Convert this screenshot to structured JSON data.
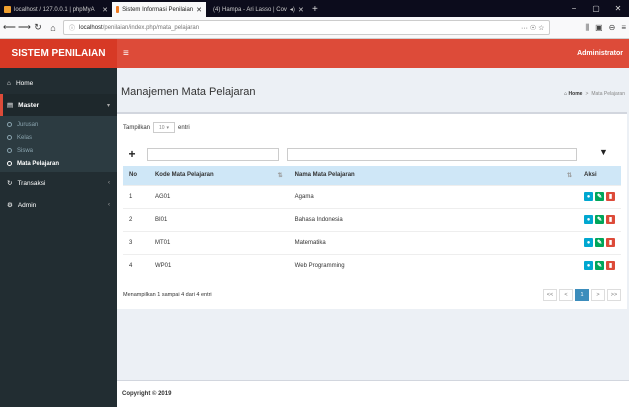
{
  "browser": {
    "tabs": [
      {
        "label": "localhost / 127.0.0.1 | phpMyA",
        "color": "#f0a030"
      },
      {
        "label": "Sistem Informasi Penilaian",
        "color": "#f07b20"
      },
      {
        "label": "(4) Hampa - Ari Lasso | Cov",
        "color": "#ff0000"
      }
    ],
    "new_tab": "+",
    "url_host": "localhost",
    "url_path": "/penilaian/index.php/mata_pelajaran",
    "url_icons": "··· ☉ ☆"
  },
  "app": {
    "logo": "SISTEM PENILAIAN",
    "user": "Administrator"
  },
  "sidebar": {
    "home": "Home",
    "master": "Master",
    "sub": [
      "Jurusan",
      "Kelas",
      "Siswa",
      "Mata Pelajaran"
    ],
    "transaksi": "Transaksi",
    "admin": "Admin"
  },
  "page": {
    "title": "Manajemen Mata Pelajaran",
    "crumb_home": "Home",
    "crumb_sep": ">",
    "crumb_current": "Mata Pelajaran"
  },
  "table": {
    "show_label": "Tampilkan",
    "show_value": "10",
    "entries_label": "entri",
    "headers": [
      "No",
      "Kode Mata Pelajaran",
      "Nama Mata Pelajaran",
      "Aksi"
    ],
    "rows": [
      {
        "no": "1",
        "kode": "AG01",
        "nama": "Agama"
      },
      {
        "no": "2",
        "kode": "BI01",
        "nama": "Bahasa Indonesia"
      },
      {
        "no": "3",
        "kode": "MT01",
        "nama": "Matematika"
      },
      {
        "no": "4",
        "kode": "WP01",
        "nama": "Web Programming"
      }
    ],
    "info": "Menampilkan 1 sampai 4 dari 4 entri",
    "pager": [
      "<<",
      "<",
      "1",
      ">",
      ">>"
    ]
  },
  "footer": "Copyright © 2019"
}
